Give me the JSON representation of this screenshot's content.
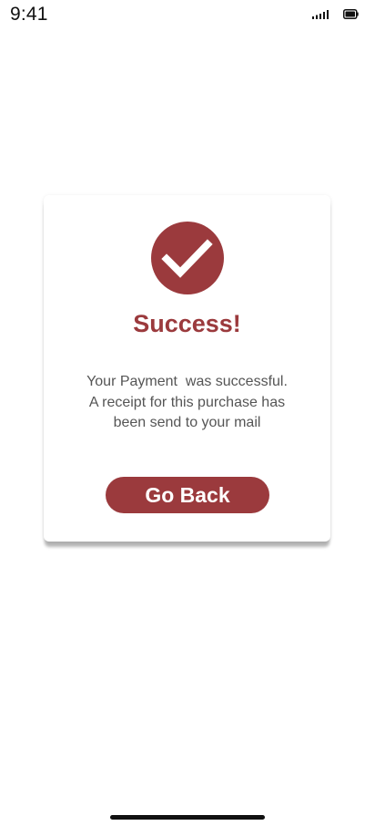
{
  "status_bar": {
    "time": "9:41",
    "signal_icon": "cellular-signal-icon",
    "battery_icon": "battery-icon"
  },
  "card": {
    "icon": "checkmark-icon",
    "title": "Success!",
    "message_lines": [
      "Your Payment  was successful.",
      "A receipt for this purchase has",
      "been send to your mail"
    ],
    "button_label": "Go Back"
  },
  "colors": {
    "accent": "#9b3a3d",
    "text_muted": "#555555",
    "background": "#ffffff"
  }
}
